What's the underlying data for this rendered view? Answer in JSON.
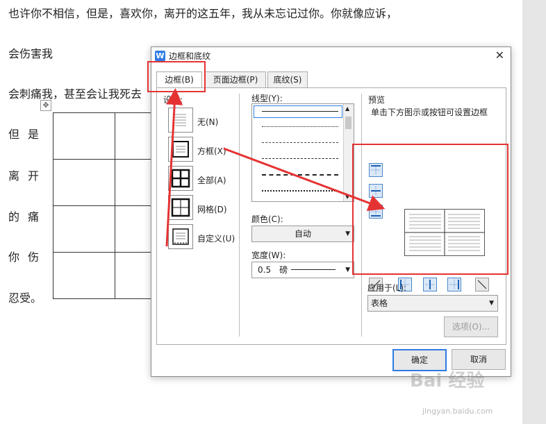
{
  "document": {
    "line1": "也许你不相信，但是，喜欢你，离开的这五年，我从未忘记过你。你就像应诉，",
    "line2": "会伤害我",
    "line3": "会刺痛我，甚至会让我死去",
    "table_rows": [
      [
        "但",
        "是"
      ],
      [
        "离",
        "开"
      ],
      [
        "的",
        "痛"
      ],
      [
        "你",
        "伤"
      ]
    ],
    "line_last": "忍受。",
    "move_handle_icon": "move-cross-icon"
  },
  "dialog": {
    "title": "边框和底纹",
    "close_icon": "close-icon",
    "tabs": [
      {
        "label": "边框(B)",
        "active": true
      },
      {
        "label": "页面边框(P)",
        "active": false
      },
      {
        "label": "底纹(S)",
        "active": false
      }
    ],
    "settings": {
      "heading": "设置:",
      "items": [
        "无(N)",
        "方框(X)",
        "全部(A)",
        "网格(D)",
        "自定义(U)"
      ]
    },
    "line_style_label": "线型(Y):",
    "color_label": "颜色(C):",
    "color_value": "自动",
    "width_label": "宽度(W):",
    "width_value": "0.5　磅",
    "preview_label": "预览",
    "preview_hint": "单击下方图示或按钮可设置边框",
    "apply_to_label": "应用于(L):",
    "apply_to_value": "表格",
    "options_button": "选项(O)...",
    "ok_button": "确定",
    "cancel_button": "取消"
  },
  "watermark": {
    "brand": "Bai 经验",
    "url": "jingyan.baidu.com"
  },
  "colors": {
    "annotation": "#e53333",
    "accent": "#2d7be5"
  }
}
